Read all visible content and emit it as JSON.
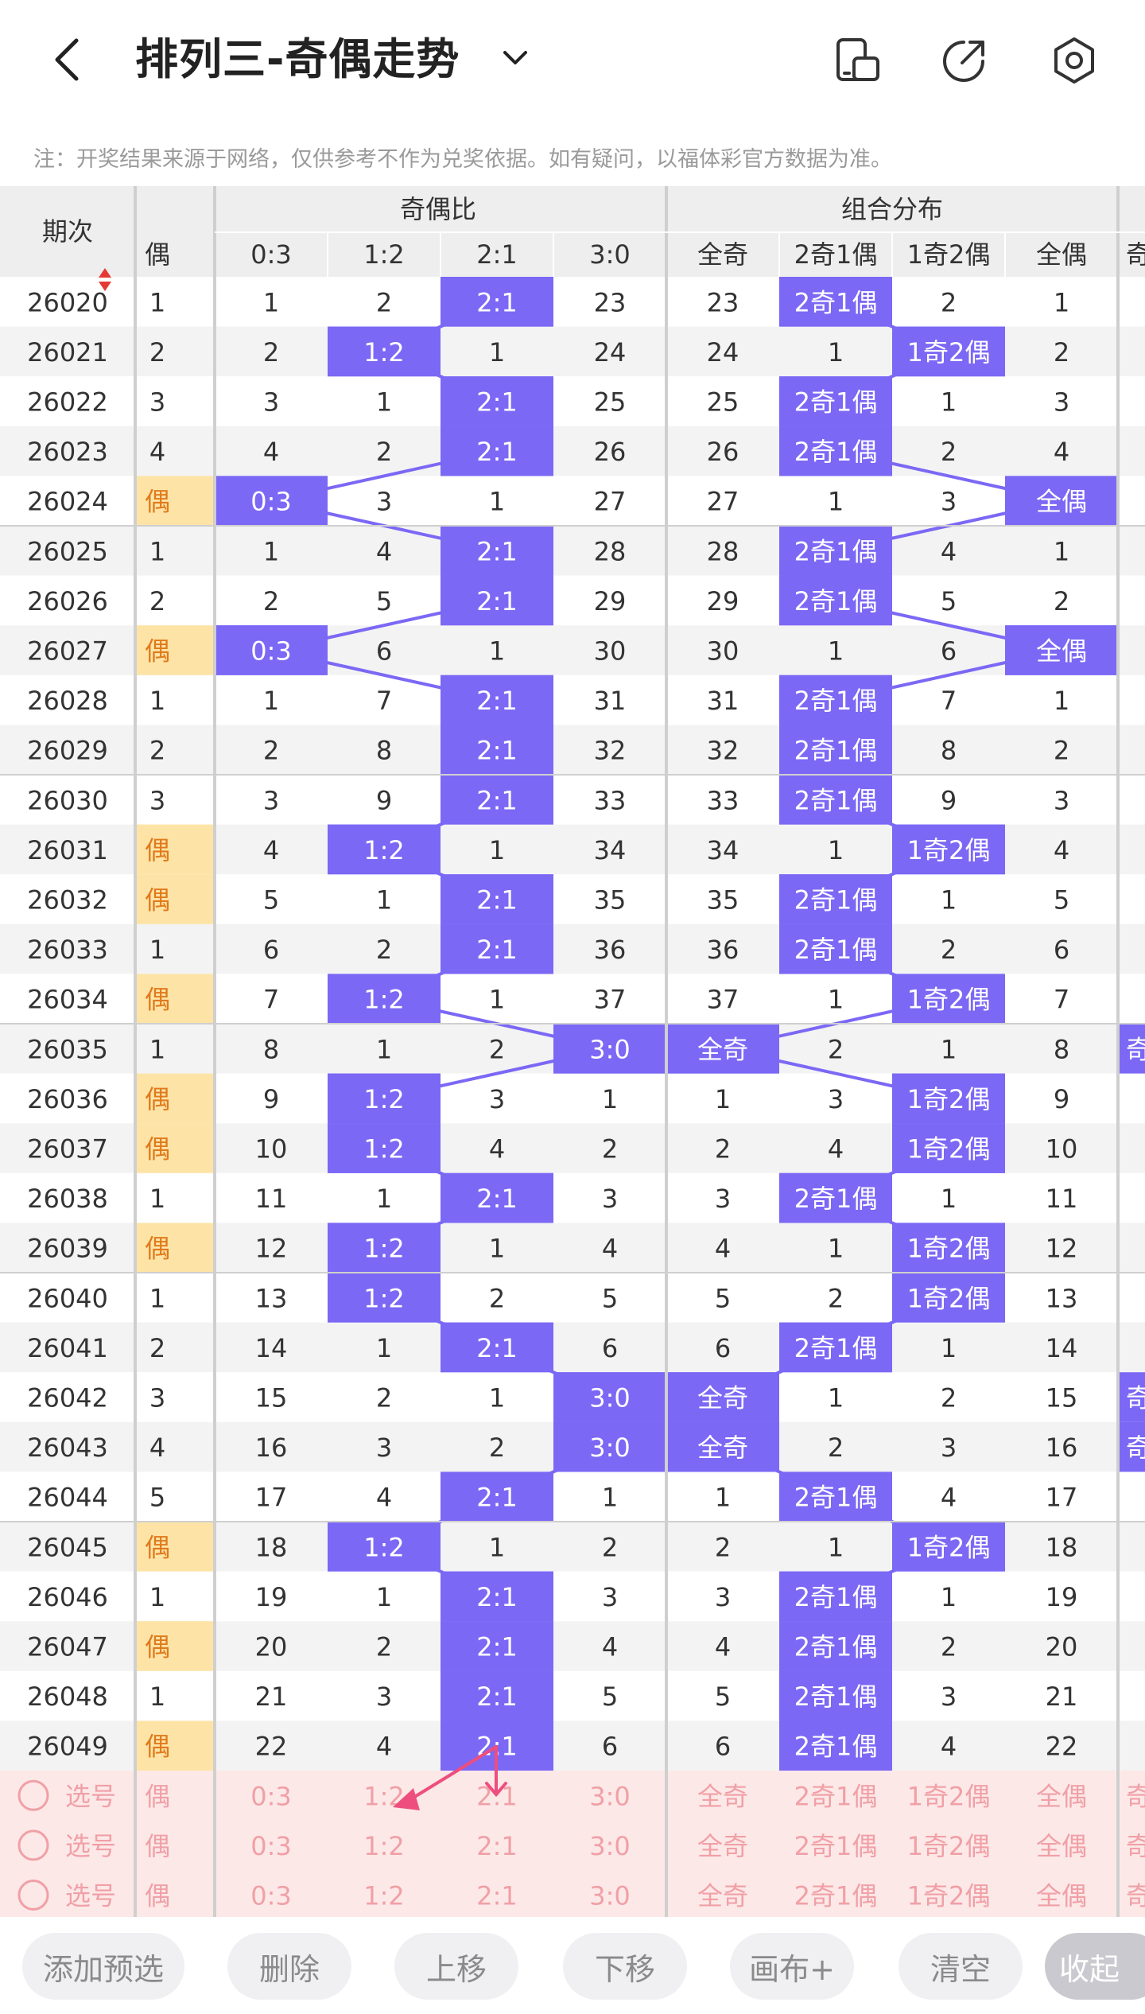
{
  "header": {
    "title": "排列三-奇偶走势",
    "back_icon": "chevron-left-icon",
    "dropdown_icon": "chevron-down-icon",
    "icons": [
      "phone-layout-icon",
      "share-icon",
      "settings-icon"
    ]
  },
  "notice": "注：开奖结果来源于网络，仅供参考不作为兑奖依据。如有疑问，以福体彩官方数据为准。",
  "table": {
    "period_header": "期次",
    "sort_icon": "sort-arrows-icon",
    "ratio_group": "奇偶比",
    "combo_group": "组合分布",
    "first_col_header": "偶",
    "ratio_cols": [
      "0:3",
      "1:2",
      "2:1",
      "3:0"
    ],
    "combo_cols": [
      "全奇",
      "2奇1偶",
      "1奇2偶",
      "全偶"
    ],
    "cut_col_text": "奇",
    "rows": [
      {
        "period": "26020",
        "c0": "1",
        "ratio": [
          "1",
          "2",
          "2:1",
          "23"
        ],
        "combo": [
          "23",
          "2奇1偶",
          "2",
          "1"
        ]
      },
      {
        "period": "26021",
        "c0": "2",
        "ratio": [
          "2",
          "1:2",
          "1",
          "24"
        ],
        "combo": [
          "24",
          "1",
          "1奇2偶",
          "2"
        ]
      },
      {
        "period": "26022",
        "c0": "3",
        "ratio": [
          "3",
          "1",
          "2:1",
          "25"
        ],
        "combo": [
          "25",
          "2奇1偶",
          "1",
          "3"
        ]
      },
      {
        "period": "26023",
        "c0": "4",
        "ratio": [
          "4",
          "2",
          "2:1",
          "26"
        ],
        "combo": [
          "26",
          "2奇1偶",
          "2",
          "4"
        ]
      },
      {
        "period": "26024",
        "c0": "偶",
        "ratio": [
          "0:3",
          "3",
          "1",
          "27"
        ],
        "combo": [
          "27",
          "1",
          "3",
          "全偶"
        ]
      },
      {
        "period": "26025",
        "c0": "1",
        "ratio": [
          "1",
          "4",
          "2:1",
          "28"
        ],
        "combo": [
          "28",
          "2奇1偶",
          "4",
          "1"
        ]
      },
      {
        "period": "26026",
        "c0": "2",
        "ratio": [
          "2",
          "5",
          "2:1",
          "29"
        ],
        "combo": [
          "29",
          "2奇1偶",
          "5",
          "2"
        ]
      },
      {
        "period": "26027",
        "c0": "偶",
        "ratio": [
          "0:3",
          "6",
          "1",
          "30"
        ],
        "combo": [
          "30",
          "1",
          "6",
          "全偶"
        ]
      },
      {
        "period": "26028",
        "c0": "1",
        "ratio": [
          "1",
          "7",
          "2:1",
          "31"
        ],
        "combo": [
          "31",
          "2奇1偶",
          "7",
          "1"
        ]
      },
      {
        "period": "26029",
        "c0": "2",
        "ratio": [
          "2",
          "8",
          "2:1",
          "32"
        ],
        "combo": [
          "32",
          "2奇1偶",
          "8",
          "2"
        ]
      },
      {
        "period": "26030",
        "c0": "3",
        "ratio": [
          "3",
          "9",
          "2:1",
          "33"
        ],
        "combo": [
          "33",
          "2奇1偶",
          "9",
          "3"
        ]
      },
      {
        "period": "26031",
        "c0": "偶",
        "ratio": [
          "4",
          "1:2",
          "1",
          "34"
        ],
        "combo": [
          "34",
          "1",
          "1奇2偶",
          "4"
        ]
      },
      {
        "period": "26032",
        "c0": "偶",
        "ratio": [
          "5",
          "1",
          "2:1",
          "35"
        ],
        "combo": [
          "35",
          "2奇1偶",
          "1",
          "5"
        ]
      },
      {
        "period": "26033",
        "c0": "1",
        "ratio": [
          "6",
          "2",
          "2:1",
          "36"
        ],
        "combo": [
          "36",
          "2奇1偶",
          "2",
          "6"
        ]
      },
      {
        "period": "26034",
        "c0": "偶",
        "ratio": [
          "7",
          "1:2",
          "1",
          "37"
        ],
        "combo": [
          "37",
          "1",
          "1奇2偶",
          "7"
        ]
      },
      {
        "period": "26035",
        "c0": "1",
        "ratio": [
          "8",
          "1",
          "2",
          "3:0"
        ],
        "combo": [
          "全奇",
          "2",
          "1",
          "8"
        ]
      },
      {
        "period": "26036",
        "c0": "偶",
        "ratio": [
          "9",
          "1:2",
          "3",
          "1"
        ],
        "combo": [
          "1",
          "3",
          "1奇2偶",
          "9"
        ]
      },
      {
        "period": "26037",
        "c0": "偶",
        "ratio": [
          "10",
          "1:2",
          "4",
          "2"
        ],
        "combo": [
          "2",
          "4",
          "1奇2偶",
          "10"
        ]
      },
      {
        "period": "26038",
        "c0": "1",
        "ratio": [
          "11",
          "1",
          "2:1",
          "3"
        ],
        "combo": [
          "3",
          "2奇1偶",
          "1",
          "11"
        ]
      },
      {
        "period": "26039",
        "c0": "偶",
        "ratio": [
          "12",
          "1:2",
          "1",
          "4"
        ],
        "combo": [
          "4",
          "1",
          "1奇2偶",
          "12"
        ]
      },
      {
        "period": "26040",
        "c0": "1",
        "ratio": [
          "13",
          "1:2",
          "2",
          "5"
        ],
        "combo": [
          "5",
          "2",
          "1奇2偶",
          "13"
        ]
      },
      {
        "period": "26041",
        "c0": "2",
        "ratio": [
          "14",
          "1",
          "2:1",
          "6"
        ],
        "combo": [
          "6",
          "2奇1偶",
          "1",
          "14"
        ]
      },
      {
        "period": "26042",
        "c0": "3",
        "ratio": [
          "15",
          "2",
          "1",
          "3:0"
        ],
        "combo": [
          "全奇",
          "1",
          "2",
          "15"
        ]
      },
      {
        "period": "26043",
        "c0": "4",
        "ratio": [
          "16",
          "3",
          "2",
          "3:0"
        ],
        "combo": [
          "全奇",
          "2",
          "3",
          "16"
        ]
      },
      {
        "period": "26044",
        "c0": "5",
        "ratio": [
          "17",
          "4",
          "2:1",
          "1"
        ],
        "combo": [
          "1",
          "2奇1偶",
          "4",
          "17"
        ]
      },
      {
        "period": "26045",
        "c0": "偶",
        "ratio": [
          "18",
          "1:2",
          "1",
          "2"
        ],
        "combo": [
          "2",
          "1",
          "1奇2偶",
          "18"
        ]
      },
      {
        "period": "26046",
        "c0": "1",
        "ratio": [
          "19",
          "1",
          "2:1",
          "3"
        ],
        "combo": [
          "3",
          "2奇1偶",
          "1",
          "19"
        ]
      },
      {
        "period": "26047",
        "c0": "偶",
        "ratio": [
          "20",
          "2",
          "2:1",
          "4"
        ],
        "combo": [
          "4",
          "2奇1偶",
          "2",
          "20"
        ]
      },
      {
        "period": "26048",
        "c0": "1",
        "ratio": [
          "21",
          "3",
          "2:1",
          "5"
        ],
        "combo": [
          "5",
          "2奇1偶",
          "3",
          "21"
        ]
      },
      {
        "period": "26049",
        "c0": "偶",
        "ratio": [
          "22",
          "4",
          "2:1",
          "6"
        ],
        "combo": [
          "6",
          "2奇1偶",
          "4",
          "22"
        ]
      }
    ],
    "pick_rows": [
      {
        "label": "选号",
        "c0": "偶",
        "ratio": [
          "0:3",
          "1:2",
          "2:1",
          "3:0"
        ],
        "combo": [
          "全奇",
          "2奇1偶",
          "1奇2偶",
          "全偶"
        ]
      },
      {
        "label": "选号",
        "c0": "偶",
        "ratio": [
          "0:3",
          "1:2",
          "2:1",
          "3:0"
        ],
        "combo": [
          "全奇",
          "2奇1偶",
          "1奇2偶",
          "全偶"
        ]
      },
      {
        "label": "选号",
        "c0": "偶",
        "ratio": [
          "0:3",
          "1:2",
          "2:1",
          "3:0"
        ],
        "combo": [
          "全奇",
          "2奇1偶",
          "1奇2偶",
          "全偶"
        ]
      }
    ]
  },
  "toolbar": {
    "buttons": [
      "添加预选",
      "删除",
      "上移",
      "下移",
      "画布+",
      "清空",
      "收起"
    ]
  },
  "colors": {
    "highlight": "#7b68f5",
    "even_cell": "#fde4a6",
    "even_text": "#e07a1c",
    "pick_bg": "#fde8e8",
    "pick_text": "#f0a0a6",
    "arrow": "#ee4e7e"
  }
}
